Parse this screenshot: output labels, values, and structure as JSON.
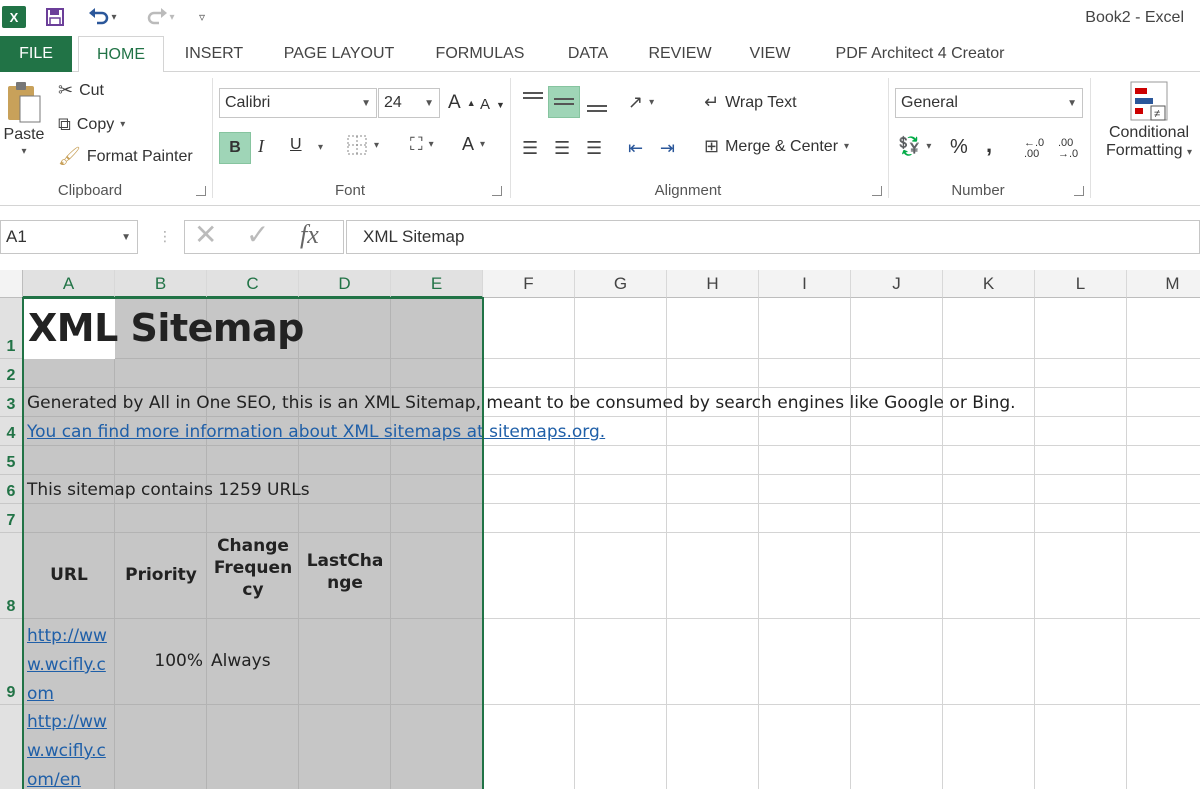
{
  "window": {
    "title": "Book2 - Excel",
    "app_icon": "excel-icon"
  },
  "quick_access": [
    "save-icon",
    "undo-icon",
    "redo-icon",
    "customize-icon"
  ],
  "tabs": [
    {
      "label": "FILE"
    },
    {
      "label": "HOME"
    },
    {
      "label": "INSERT"
    },
    {
      "label": "PAGE LAYOUT"
    },
    {
      "label": "FORMULAS"
    },
    {
      "label": "DATA"
    },
    {
      "label": "REVIEW"
    },
    {
      "label": "VIEW"
    },
    {
      "label": "PDF Architect 4 Creator"
    }
  ],
  "ribbon": {
    "clipboard": {
      "paste": "Paste",
      "cut": "Cut",
      "copy": "Copy",
      "format_painter": "Format Painter",
      "label": "Clipboard"
    },
    "font": {
      "font_name": "Calibri",
      "font_size": "24",
      "bold": "B",
      "italic": "I",
      "underline": "U",
      "font_color": "A",
      "grow": "A",
      "shrink": "A",
      "label": "Font"
    },
    "alignment": {
      "wrap_text": "Wrap Text",
      "merge_center": "Merge & Center",
      "label": "Alignment"
    },
    "number": {
      "format": "General",
      "percent": "%",
      "comma": ",",
      "inc_decimal": "←.0 .00",
      "dec_decimal": ".00 →.0",
      "label": "Number"
    },
    "styles": {
      "conditional_line1": "Conditional",
      "conditional_line2": "Formatting"
    }
  },
  "formula_bar": {
    "name_box": "A1",
    "fx": "fx",
    "value": "XML Sitemap"
  },
  "columns": [
    "A",
    "B",
    "C",
    "D",
    "E",
    "F",
    "G",
    "H",
    "I",
    "J",
    "K",
    "L",
    "M"
  ],
  "rows": [
    "1",
    "2",
    "3",
    "4",
    "5",
    "6",
    "7",
    "8",
    "9"
  ],
  "cells": {
    "a1": "XML Sitemap",
    "a3": "Generated by All in One SEO, this is an XML Sitemap, meant to be consumed by search engines like Google or Bing.",
    "a4": "You can find more information about XML sitemaps at sitemaps.org.",
    "a6": "This sitemap contains 1259 URLs",
    "a8": "URL",
    "b8": "Priority",
    "c8": "Change Frequency",
    "d8": "LastChange",
    "a9": "http://www.wcifly.com",
    "b9": "100%",
    "c9": "Always",
    "a10": "http://www.wcifly.com/en"
  },
  "colors": {
    "excel_green": "#217346",
    "selection_gray": "#c6c6c6",
    "link_blue": "#1f5fa8"
  }
}
